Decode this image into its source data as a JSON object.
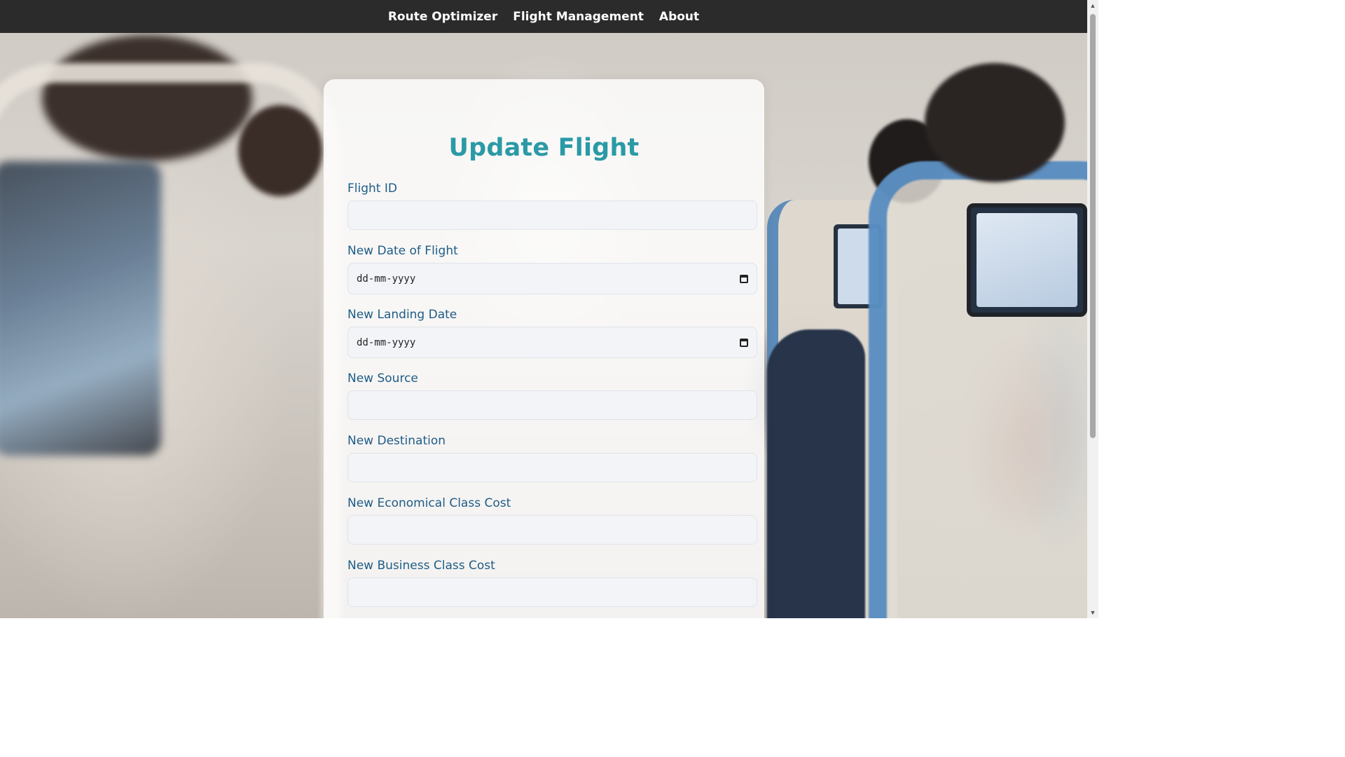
{
  "navbar": {
    "links": [
      {
        "label": "Route Optimizer"
      },
      {
        "label": "Flight Management"
      },
      {
        "label": "About"
      }
    ]
  },
  "form": {
    "title": "Update Flight",
    "fields": [
      {
        "label": "Flight ID",
        "value": ""
      },
      {
        "label": "New Date of Flight",
        "placeholder": "dd-mm-yyyy",
        "icon": "calendar-icon"
      },
      {
        "label": "New Landing Date",
        "placeholder": "dd-mm-yyyy",
        "icon": "calendar-icon"
      },
      {
        "label": "New Source",
        "value": ""
      },
      {
        "label": "New Destination",
        "value": ""
      },
      {
        "label": "New Economical Class Cost",
        "value": ""
      },
      {
        "label": "New Business Class Cost",
        "value": ""
      }
    ]
  },
  "colors": {
    "navbar_bg": "#2b2b2b",
    "title": "#2b9aa6",
    "label": "#1f5c86",
    "input_bg": "#f2f4f7"
  }
}
